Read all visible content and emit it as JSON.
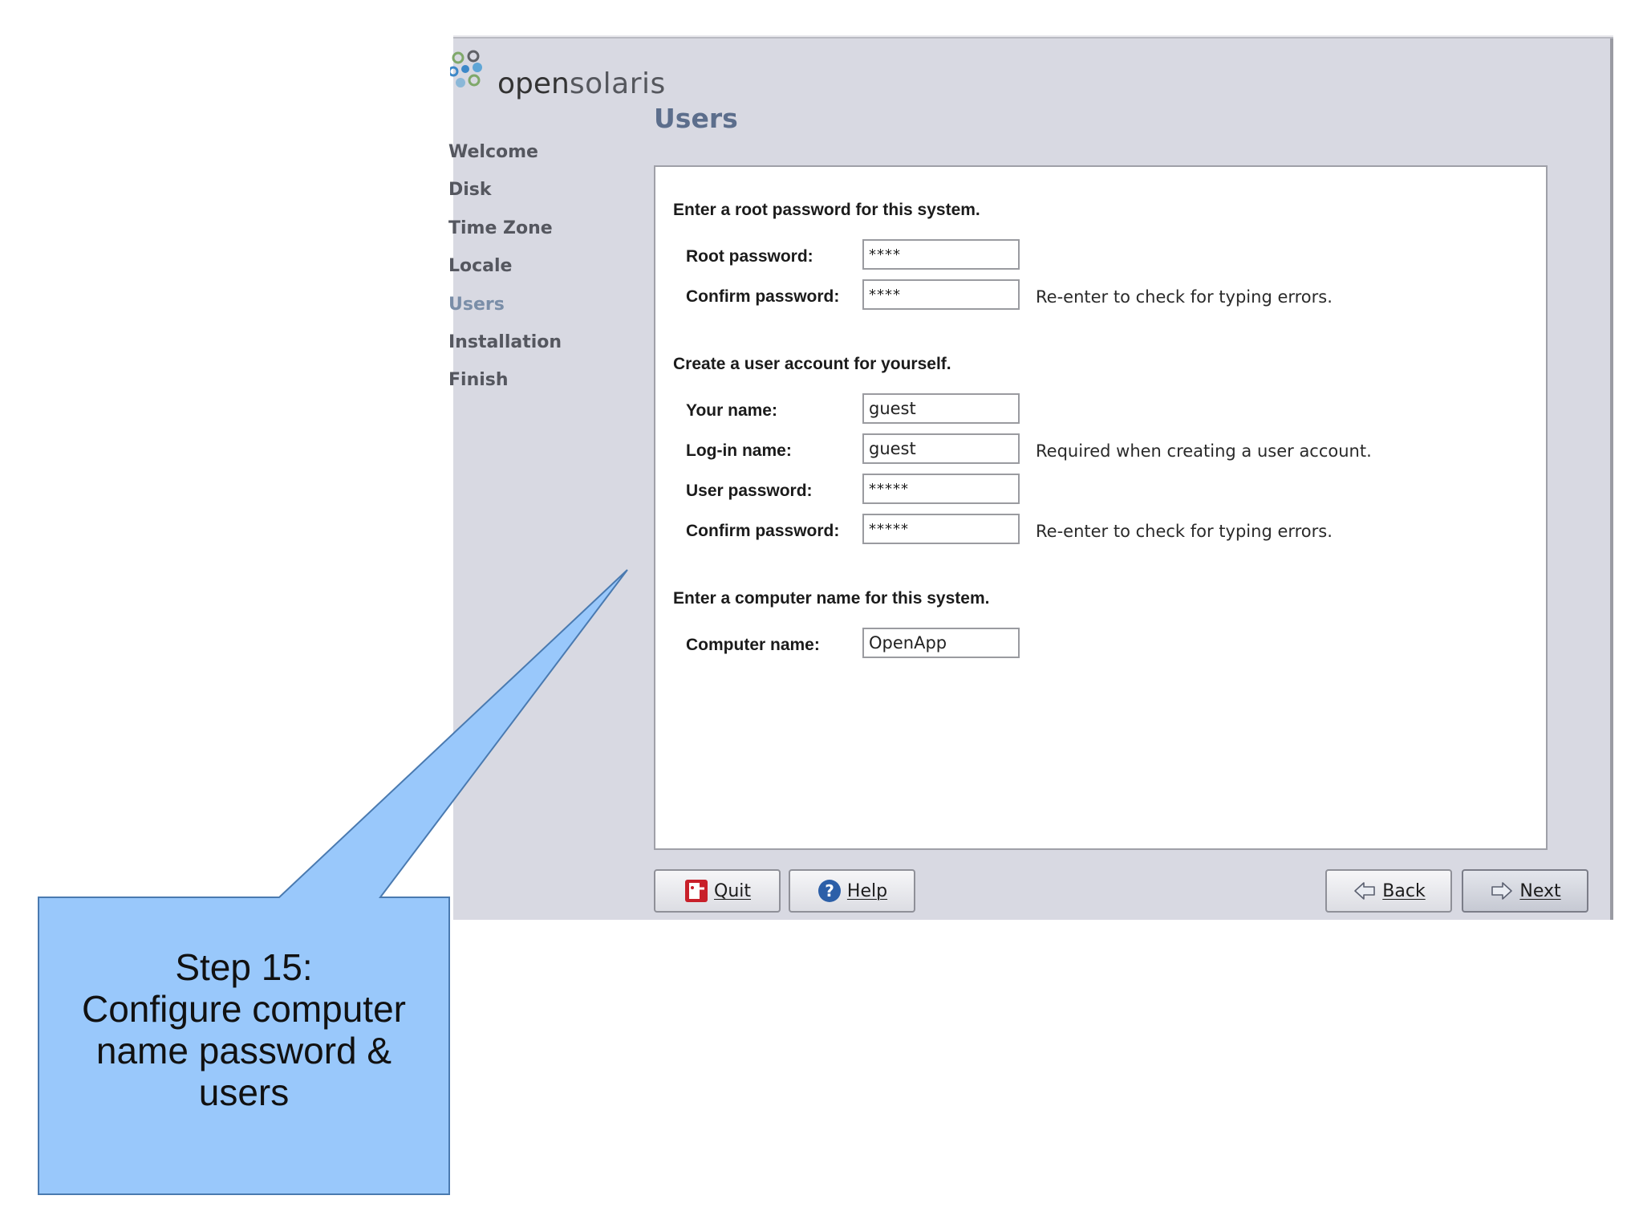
{
  "logo": {
    "text_bold": "open",
    "text_light": "solaris"
  },
  "sidebar": {
    "steps": [
      {
        "label": "Welcome"
      },
      {
        "label": "Disk"
      },
      {
        "label": "Time Zone"
      },
      {
        "label": "Locale"
      },
      {
        "label": "Users"
      },
      {
        "label": "Installation"
      },
      {
        "label": "Finish"
      }
    ],
    "current": "Users"
  },
  "page_title": "Users",
  "root_section": {
    "heading": "Enter a root password for this system.",
    "root_password": {
      "label": "Root password:",
      "value": "****"
    },
    "confirm_password": {
      "label": "Confirm password:",
      "value": "****",
      "hint": "Re-enter to check for typing errors."
    }
  },
  "user_section": {
    "heading": "Create a user account for yourself.",
    "your_name": {
      "label": "Your name:",
      "value": "guest"
    },
    "login_name": {
      "label": "Log-in name:",
      "value": "guest",
      "hint": "Required when creating a user account."
    },
    "user_password": {
      "label": "User password:",
      "value": "*****"
    },
    "confirm_password": {
      "label": "Confirm password:",
      "value": "*****",
      "hint": "Re-enter to check for typing errors."
    }
  },
  "computer_section": {
    "heading": "Enter a computer name for this system.",
    "computer_name": {
      "label": "Computer name:",
      "value": "OpenApp"
    }
  },
  "buttons": {
    "quit": "Quit",
    "help": "Help",
    "back": "Back",
    "next": "Next"
  },
  "callout": {
    "text": "Step 15:\nConfigure computer\nname password &\nusers",
    "fill": "#99c8fb",
    "stroke": "#4a7ab0"
  },
  "colors": {
    "window_bg": "#d8d9e2",
    "title": "#5c6e8c",
    "current_step": "#7a8ea8"
  }
}
